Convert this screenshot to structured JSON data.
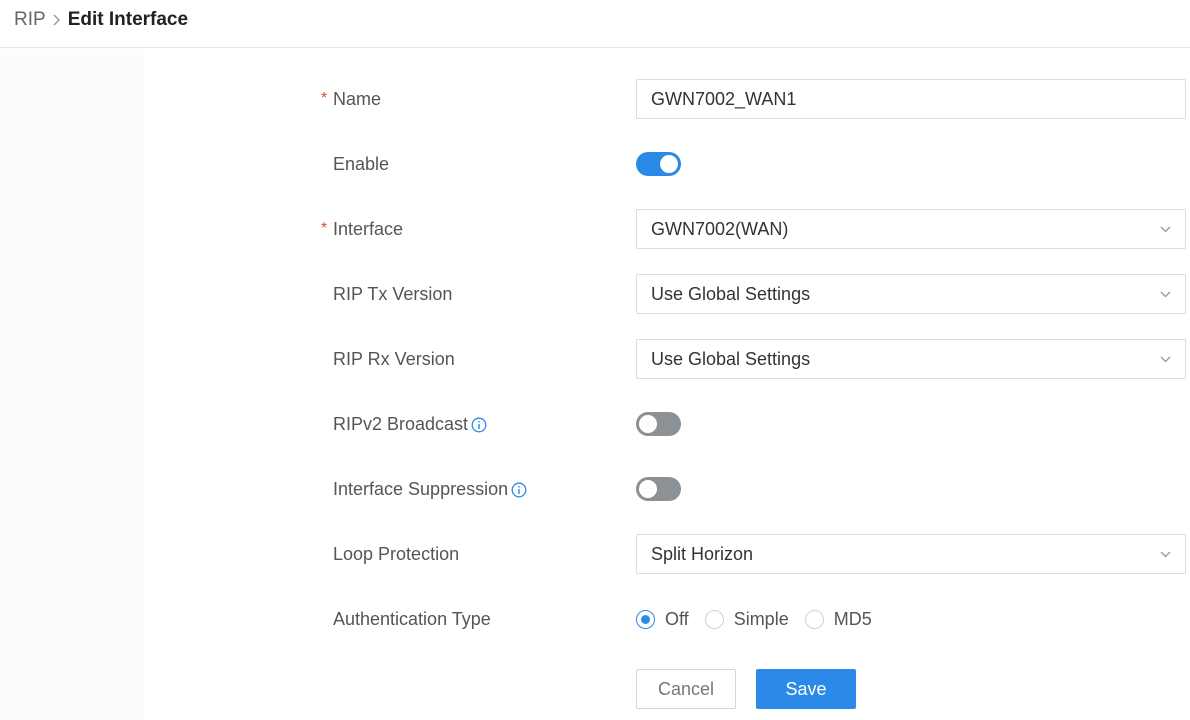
{
  "breadcrumb": {
    "parent": "RIP",
    "current": "Edit Interface"
  },
  "form": {
    "name": {
      "label": "Name",
      "required_mark": "*",
      "value": "GWN7002_WAN1"
    },
    "enable": {
      "label": "Enable",
      "on": true
    },
    "interface": {
      "label": "Interface",
      "required_mark": "*",
      "value": "GWN7002(WAN)"
    },
    "rip_tx_version": {
      "label": "RIP Tx Version",
      "value": "Use Global Settings"
    },
    "rip_rx_version": {
      "label": "RIP Rx Version",
      "value": "Use Global Settings"
    },
    "ripv2_broadcast": {
      "label": "RIPv2 Broadcast",
      "on": false
    },
    "interface_suppression": {
      "label": "Interface Suppression",
      "on": false
    },
    "loop_protection": {
      "label": "Loop Protection",
      "value": "Split Horizon"
    },
    "authentication_type": {
      "label": "Authentication Type",
      "options": [
        "Off",
        "Simple",
        "MD5"
      ],
      "selected": "Off"
    }
  },
  "actions": {
    "cancel_label": "Cancel",
    "save_label": "Save"
  },
  "colors": {
    "accent": "#2b8ae8",
    "required": "#e8473b",
    "toggle_off": "#8c9196"
  },
  "icons": {
    "breadcrumb_separator": "chevron-right-icon",
    "dropdown": "chevron-down-icon",
    "info": "info-icon"
  }
}
